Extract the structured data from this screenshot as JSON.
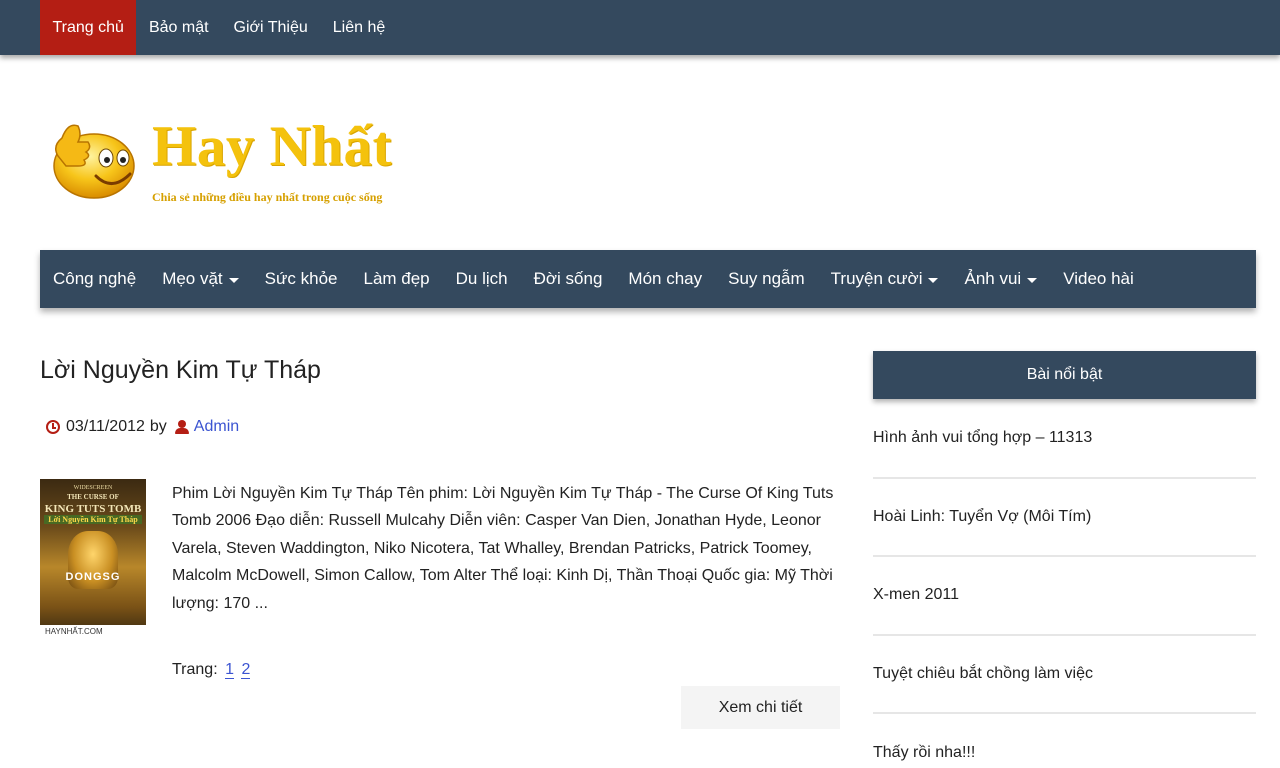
{
  "topnav": {
    "items": [
      "Trang chủ",
      "Bảo mật",
      "Giới Thiệu",
      "Liên hệ"
    ]
  },
  "logo": {
    "title": "Hay Nhất",
    "tagline": "Chia sẻ những điều hay nhất trong cuộc sống"
  },
  "mainnav": {
    "items": [
      {
        "label": "Công nghệ",
        "caret": false
      },
      {
        "label": "Mẹo vặt",
        "caret": true
      },
      {
        "label": "Sức khỏe",
        "caret": false
      },
      {
        "label": "Làm đẹp",
        "caret": false
      },
      {
        "label": "Du lịch",
        "caret": false
      },
      {
        "label": "Đời sống",
        "caret": false
      },
      {
        "label": "Món chay",
        "caret": false
      },
      {
        "label": "Suy ngẫm",
        "caret": false
      },
      {
        "label": "Truyện cười",
        "caret": true
      },
      {
        "label": "Ảnh vui",
        "caret": true
      },
      {
        "label": "Video hài",
        "caret": false
      }
    ]
  },
  "post": {
    "title": "Lời Nguyền Kim Tự Tháp",
    "date": "03/11/2012",
    "by": "by",
    "author": "Admin",
    "excerpt": "Phim Lời Nguyền Kim Tự Tháp Tên phim: Lời Nguyền Kim Tự Tháp - The Curse Of King Tuts Tomb 2006 Đạo diễn: Russell Mulcahy Diễn viên: Casper Van Dien, Jonathan Hyde, Leonor Varela, Steven Waddington, Niko Nicotera, Tat Whalley, Brendan Patricks, Patrick Toomey, Malcolm McDowell, Simon Callow, Tom Alter Thể loại: Kinh Dị, Thần Thoại Quốc gia: Mỹ Thời lượng: 170 ...",
    "thumb": {
      "line1": "WIDESCREEN",
      "line2a": "THE CURSE OF",
      "line2b": "KING TUTS TOMB",
      "line3": "Lời Nguyền Kim Tự Tháp",
      "line4": "DONGSG",
      "footer": "HAYNHẤT.COM"
    },
    "pages_label": "Trang:",
    "pages": [
      "1",
      "2"
    ],
    "readmore": "Xem chi tiết"
  },
  "sidebar": {
    "heading": "Bài nổi bật",
    "items": [
      "Hình ảnh vui tổng hợp – 11313",
      "Hoài Linh: Tuyển Vợ (Môi Tím)",
      "X-men 2011",
      "Tuyệt chiêu bắt chồng làm việc",
      "Thấy rồi nha!!!"
    ]
  },
  "colors": {
    "nav_bg": "#34495e",
    "active_bg": "#b41e14",
    "logo_yellow": "#f4c20d",
    "link_blue": "#3b54d1"
  }
}
